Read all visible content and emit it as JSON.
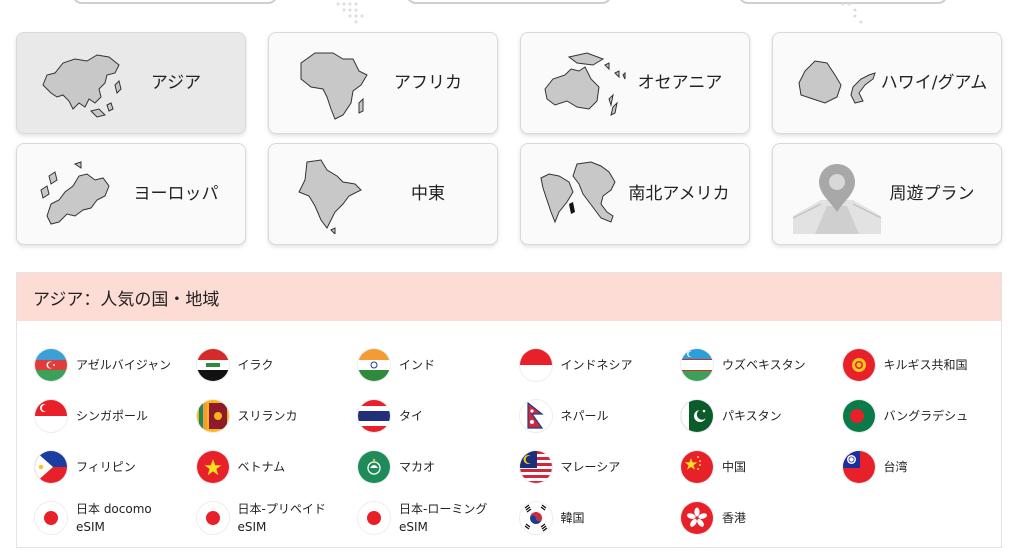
{
  "regions": [
    {
      "label": "アジア",
      "map": "asia-map-icon",
      "active": true
    },
    {
      "label": "アフリカ",
      "map": "africa-map-icon"
    },
    {
      "label": "オセアニア",
      "map": "oceania-map-icon"
    },
    {
      "label": "ハワイ/グアム",
      "map": "hawaii-guam-map-icon"
    },
    {
      "label": "ヨーロッパ",
      "map": "europe-map-icon"
    },
    {
      "label": "中東",
      "map": "middle-east-map-icon"
    },
    {
      "label": "南北アメリカ",
      "map": "americas-map-icon"
    },
    {
      "label": "周遊プラン",
      "map": "roaming-plan-icon"
    }
  ],
  "panel": {
    "title": "アジア：人気の国・地域"
  },
  "countries": [
    {
      "name": "アゼルバイジャン",
      "flag": "azerbaijan-flag-icon"
    },
    {
      "name": "イラク",
      "flag": "iraq-flag-icon"
    },
    {
      "name": "インド",
      "flag": "india-flag-icon"
    },
    {
      "name": "インドネシア",
      "flag": "indonesia-flag-icon"
    },
    {
      "name": "ウズベキスタン",
      "flag": "uzbekistan-flag-icon"
    },
    {
      "name": "キルギス共和国",
      "flag": "kyrgyzstan-flag-icon"
    },
    {
      "name": "シンガポール",
      "flag": "singapore-flag-icon"
    },
    {
      "name": "スリランカ",
      "flag": "sri-lanka-flag-icon"
    },
    {
      "name": "タイ",
      "flag": "thailand-flag-icon"
    },
    {
      "name": "ネパール",
      "flag": "nepal-flag-icon"
    },
    {
      "name": "パキスタン",
      "flag": "pakistan-flag-icon"
    },
    {
      "name": "バングラデシュ",
      "flag": "bangladesh-flag-icon"
    },
    {
      "name": "フィリピン",
      "flag": "philippines-flag-icon"
    },
    {
      "name": "ベトナム",
      "flag": "vietnam-flag-icon"
    },
    {
      "name": "マカオ",
      "flag": "macau-flag-icon"
    },
    {
      "name": "マレーシア",
      "flag": "malaysia-flag-icon"
    },
    {
      "name": "中国",
      "flag": "china-flag-icon"
    },
    {
      "name": "台湾",
      "flag": "taiwan-flag-icon"
    },
    {
      "name": "日本 docomo eSIM",
      "flag": "japan-flag-icon"
    },
    {
      "name": "日本-プリペイド eSIM",
      "flag": "japan-flag-icon"
    },
    {
      "name": "日本-ローミング eSIM",
      "flag": "japan-flag-icon"
    },
    {
      "name": "韓国",
      "flag": "korea-flag-icon"
    },
    {
      "name": "香港",
      "flag": "hong-kong-flag-icon"
    }
  ],
  "colors": {
    "panel_header_bg": "#fcdcd4",
    "card_bg": "#fafafa",
    "card_active_bg": "#e9e9e9"
  }
}
